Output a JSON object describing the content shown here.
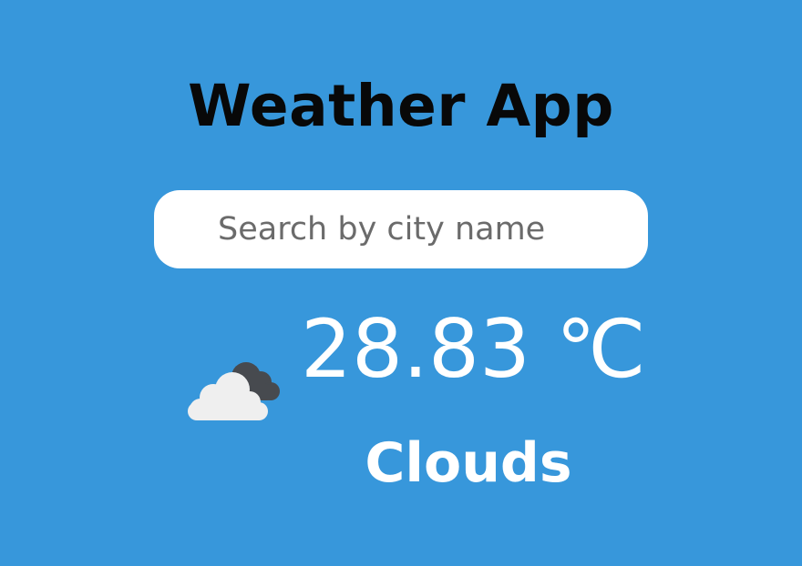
{
  "app": {
    "title": "Weather App",
    "background_color": "#3797db"
  },
  "search": {
    "placeholder": "Search by city name",
    "value": ""
  },
  "weather": {
    "icon": "clouds-icon",
    "temperature": "28.83 ℃",
    "condition": "Clouds"
  }
}
